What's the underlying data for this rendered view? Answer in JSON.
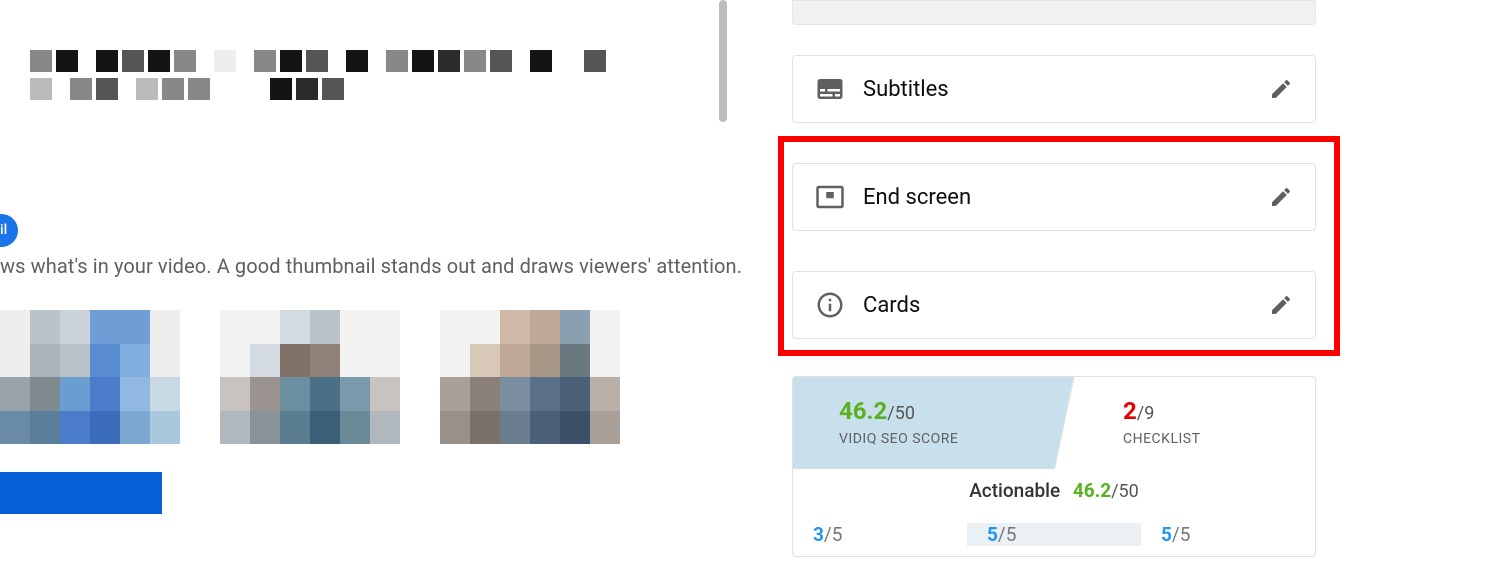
{
  "pill_fragment": "il",
  "description_text": "ws what's in your video. A good thumbnail stands out and draws viewers' attention.",
  "sidebar": {
    "subtitles": {
      "label": "Subtitles"
    },
    "end_screen": {
      "label": "End screen"
    },
    "cards": {
      "label": "Cards"
    }
  },
  "vidiq": {
    "score_value": "46.2",
    "score_max": "/50",
    "score_label": "VIDIQ SEO SCORE",
    "checklist_value": "2",
    "checklist_max": "/9",
    "checklist_label": "CHECKLIST",
    "actionable_label": "Actionable",
    "actionable_value": "46.2",
    "actionable_max": "/50",
    "metrics": [
      {
        "value": "3",
        "max": "/5"
      },
      {
        "value": "5",
        "max": "/5"
      },
      {
        "value": "5",
        "max": "/5"
      }
    ]
  }
}
